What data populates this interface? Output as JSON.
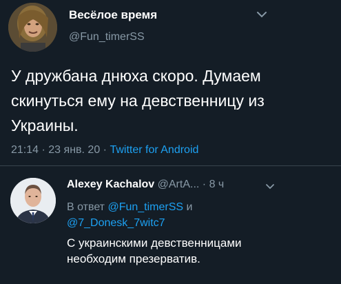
{
  "tweet": {
    "author_name": "Весёлое время",
    "author_handle": "@Fun_timerSS",
    "text": "У дружбана днюха скоро. Думаем скинуться ему на девственницу из Украины.",
    "time": "21:14",
    "date": "23 янв. 20",
    "source": "Twitter for Android",
    "separator": "·"
  },
  "reply": {
    "author_name": "Alexey Kachalov",
    "author_handle": "@ArtA...",
    "time": "8 ч",
    "reply_to_prefix": "В ответ",
    "mention_1": "@Fun_timerSS",
    "conjunction": "и",
    "mention_2": "@7_Donesk_7witc7",
    "text": "С украинскими девственницами необходим презерватив."
  },
  "colors": {
    "background": "#141d26",
    "secondary_text": "#8899a6",
    "accent": "#1da1f2",
    "divider": "#38444d"
  },
  "icons": {
    "menu": "chevron-down-icon"
  }
}
